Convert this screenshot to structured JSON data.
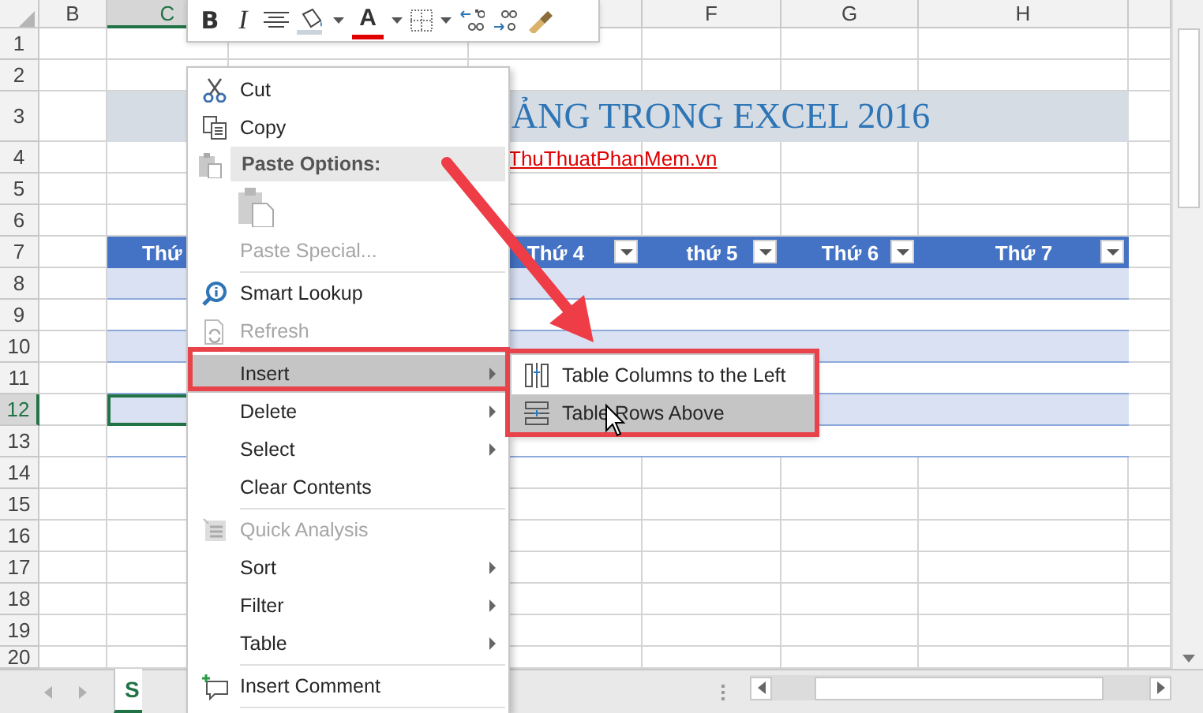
{
  "mini_toolbar": {
    "bold_label": "B",
    "italic_label": "I",
    "font_color_label": "A"
  },
  "columns": [
    {
      "label": "B",
      "selected": false
    },
    {
      "label": "C",
      "selected": true
    },
    {
      "label": "F",
      "selected": false
    },
    {
      "label": "G",
      "selected": false
    },
    {
      "label": "H",
      "selected": false
    }
  ],
  "rows": [
    {
      "label": "1",
      "selected": false
    },
    {
      "label": "2",
      "selected": false
    },
    {
      "label": "3",
      "selected": false
    },
    {
      "label": "4",
      "selected": false
    },
    {
      "label": "5",
      "selected": false
    },
    {
      "label": "6",
      "selected": false
    },
    {
      "label": "7",
      "selected": false
    },
    {
      "label": "8",
      "selected": false
    },
    {
      "label": "9",
      "selected": false
    },
    {
      "label": "10",
      "selected": false
    },
    {
      "label": "11",
      "selected": false
    },
    {
      "label": "12",
      "selected": true
    },
    {
      "label": "13",
      "selected": false
    },
    {
      "label": "14",
      "selected": false
    },
    {
      "label": "15",
      "selected": false
    },
    {
      "label": "16",
      "selected": false
    },
    {
      "label": "17",
      "selected": false
    },
    {
      "label": "18",
      "selected": false
    },
    {
      "label": "19",
      "selected": false
    },
    {
      "label": "20",
      "selected": false
    }
  ],
  "sheet_title": "ẢNG TRONG EXCEL 2016",
  "link": "ThuThuatPhanMem.vn",
  "table_headers": [
    "Thứ",
    "Thứ 4",
    "thứ 5",
    "Thứ 6",
    "Thứ 7"
  ],
  "context_menu": [
    {
      "kind": "item",
      "label": "Cut",
      "disabled": false,
      "submenu": false,
      "selected": false
    },
    {
      "kind": "item",
      "label": "Copy",
      "disabled": false,
      "submenu": false,
      "selected": false
    },
    {
      "kind": "header",
      "label": "Paste Options:"
    },
    {
      "kind": "paste_options"
    },
    {
      "kind": "item",
      "label": "Paste Special...",
      "disabled": true,
      "submenu": false,
      "selected": false
    },
    {
      "kind": "separator"
    },
    {
      "kind": "item",
      "label": "Smart Lookup",
      "disabled": false,
      "submenu": false,
      "selected": false
    },
    {
      "kind": "item",
      "label": "Refresh",
      "disabled": true,
      "submenu": false,
      "selected": false
    },
    {
      "kind": "separator"
    },
    {
      "kind": "item",
      "label": "Insert",
      "disabled": false,
      "submenu": true,
      "selected": true
    },
    {
      "kind": "item",
      "label": "Delete",
      "disabled": false,
      "submenu": true,
      "selected": false
    },
    {
      "kind": "item",
      "label": "Select",
      "disabled": false,
      "submenu": true,
      "selected": false
    },
    {
      "kind": "item",
      "label": "Clear Contents",
      "disabled": false,
      "submenu": false,
      "selected": false
    },
    {
      "kind": "separator"
    },
    {
      "kind": "item",
      "label": "Quick Analysis",
      "disabled": true,
      "submenu": false,
      "selected": false
    },
    {
      "kind": "item",
      "label": "Sort",
      "disabled": false,
      "submenu": true,
      "selected": false
    },
    {
      "kind": "item",
      "label": "Filter",
      "disabled": false,
      "submenu": true,
      "selected": false
    },
    {
      "kind": "item",
      "label": "Table",
      "disabled": false,
      "submenu": true,
      "selected": false
    },
    {
      "kind": "separator"
    },
    {
      "kind": "item",
      "label": "Insert Comment",
      "disabled": false,
      "submenu": false,
      "selected": false
    },
    {
      "kind": "separator"
    },
    {
      "kind": "partial"
    }
  ],
  "submenu": [
    {
      "label": "Table Columns to the Left",
      "selected": false
    },
    {
      "label": "Table Rows Above",
      "selected": true
    }
  ],
  "sheet_tabs": [
    {
      "label": "S",
      "selected": true
    }
  ]
}
